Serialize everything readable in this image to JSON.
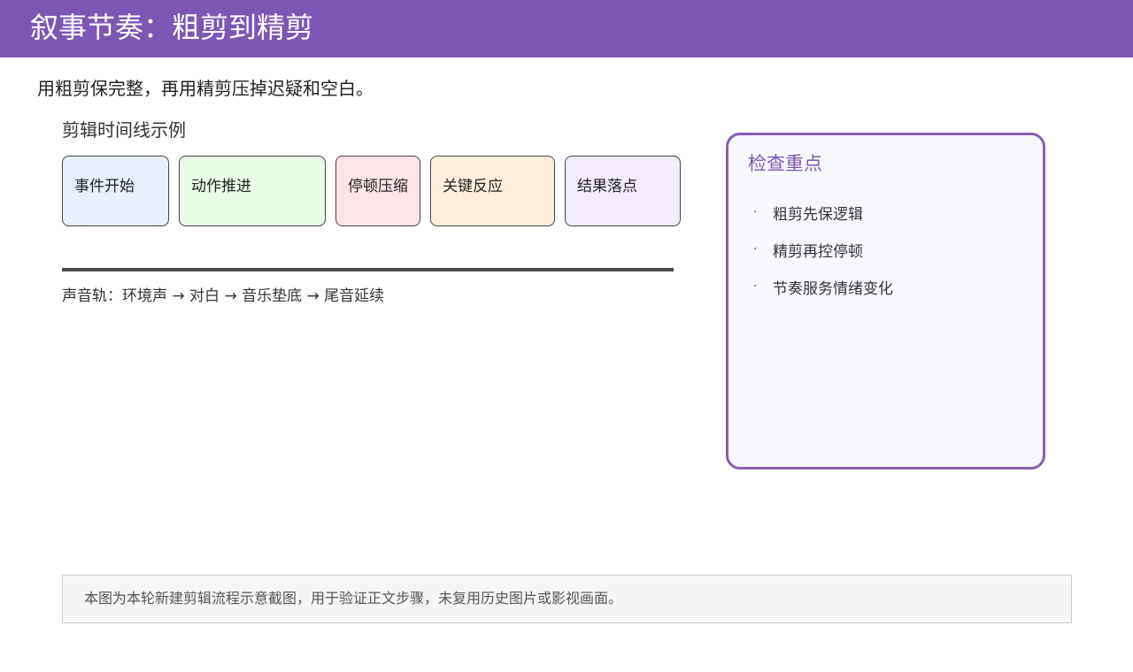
{
  "header": {
    "title": "叙事节奏：粗剪到精剪"
  },
  "subtitle": "用粗剪保完整，再用精剪压掉迟疑和空白。",
  "timeline": {
    "title": "剪辑时间线示例",
    "clips": [
      {
        "label": "事件开始"
      },
      {
        "label": "动作推进"
      },
      {
        "label": "停顿压缩"
      },
      {
        "label": "关键反应"
      },
      {
        "label": "结果落点"
      }
    ],
    "audio_track": "声音轨：环境声 → 对白 → 音乐垫底 → 尾音延续"
  },
  "checklist": {
    "title": "检查重点",
    "bullet": "·",
    "items": [
      "粗剪先保逻辑",
      "精剪再控停顿",
      "节奏服务情绪变化"
    ]
  },
  "footer": {
    "note": "本图为本轮新建剪辑流程示意截图，用于验证正文步骤，未复用历史图片或影视画面。"
  },
  "colors": {
    "accent": "#7e57b4",
    "clip_1": "#e6f0fd",
    "clip_2": "#e9fde8",
    "clip_3": "#fde4e8",
    "clip_4": "#ffefdc",
    "clip_5": "#f1ebfd"
  }
}
